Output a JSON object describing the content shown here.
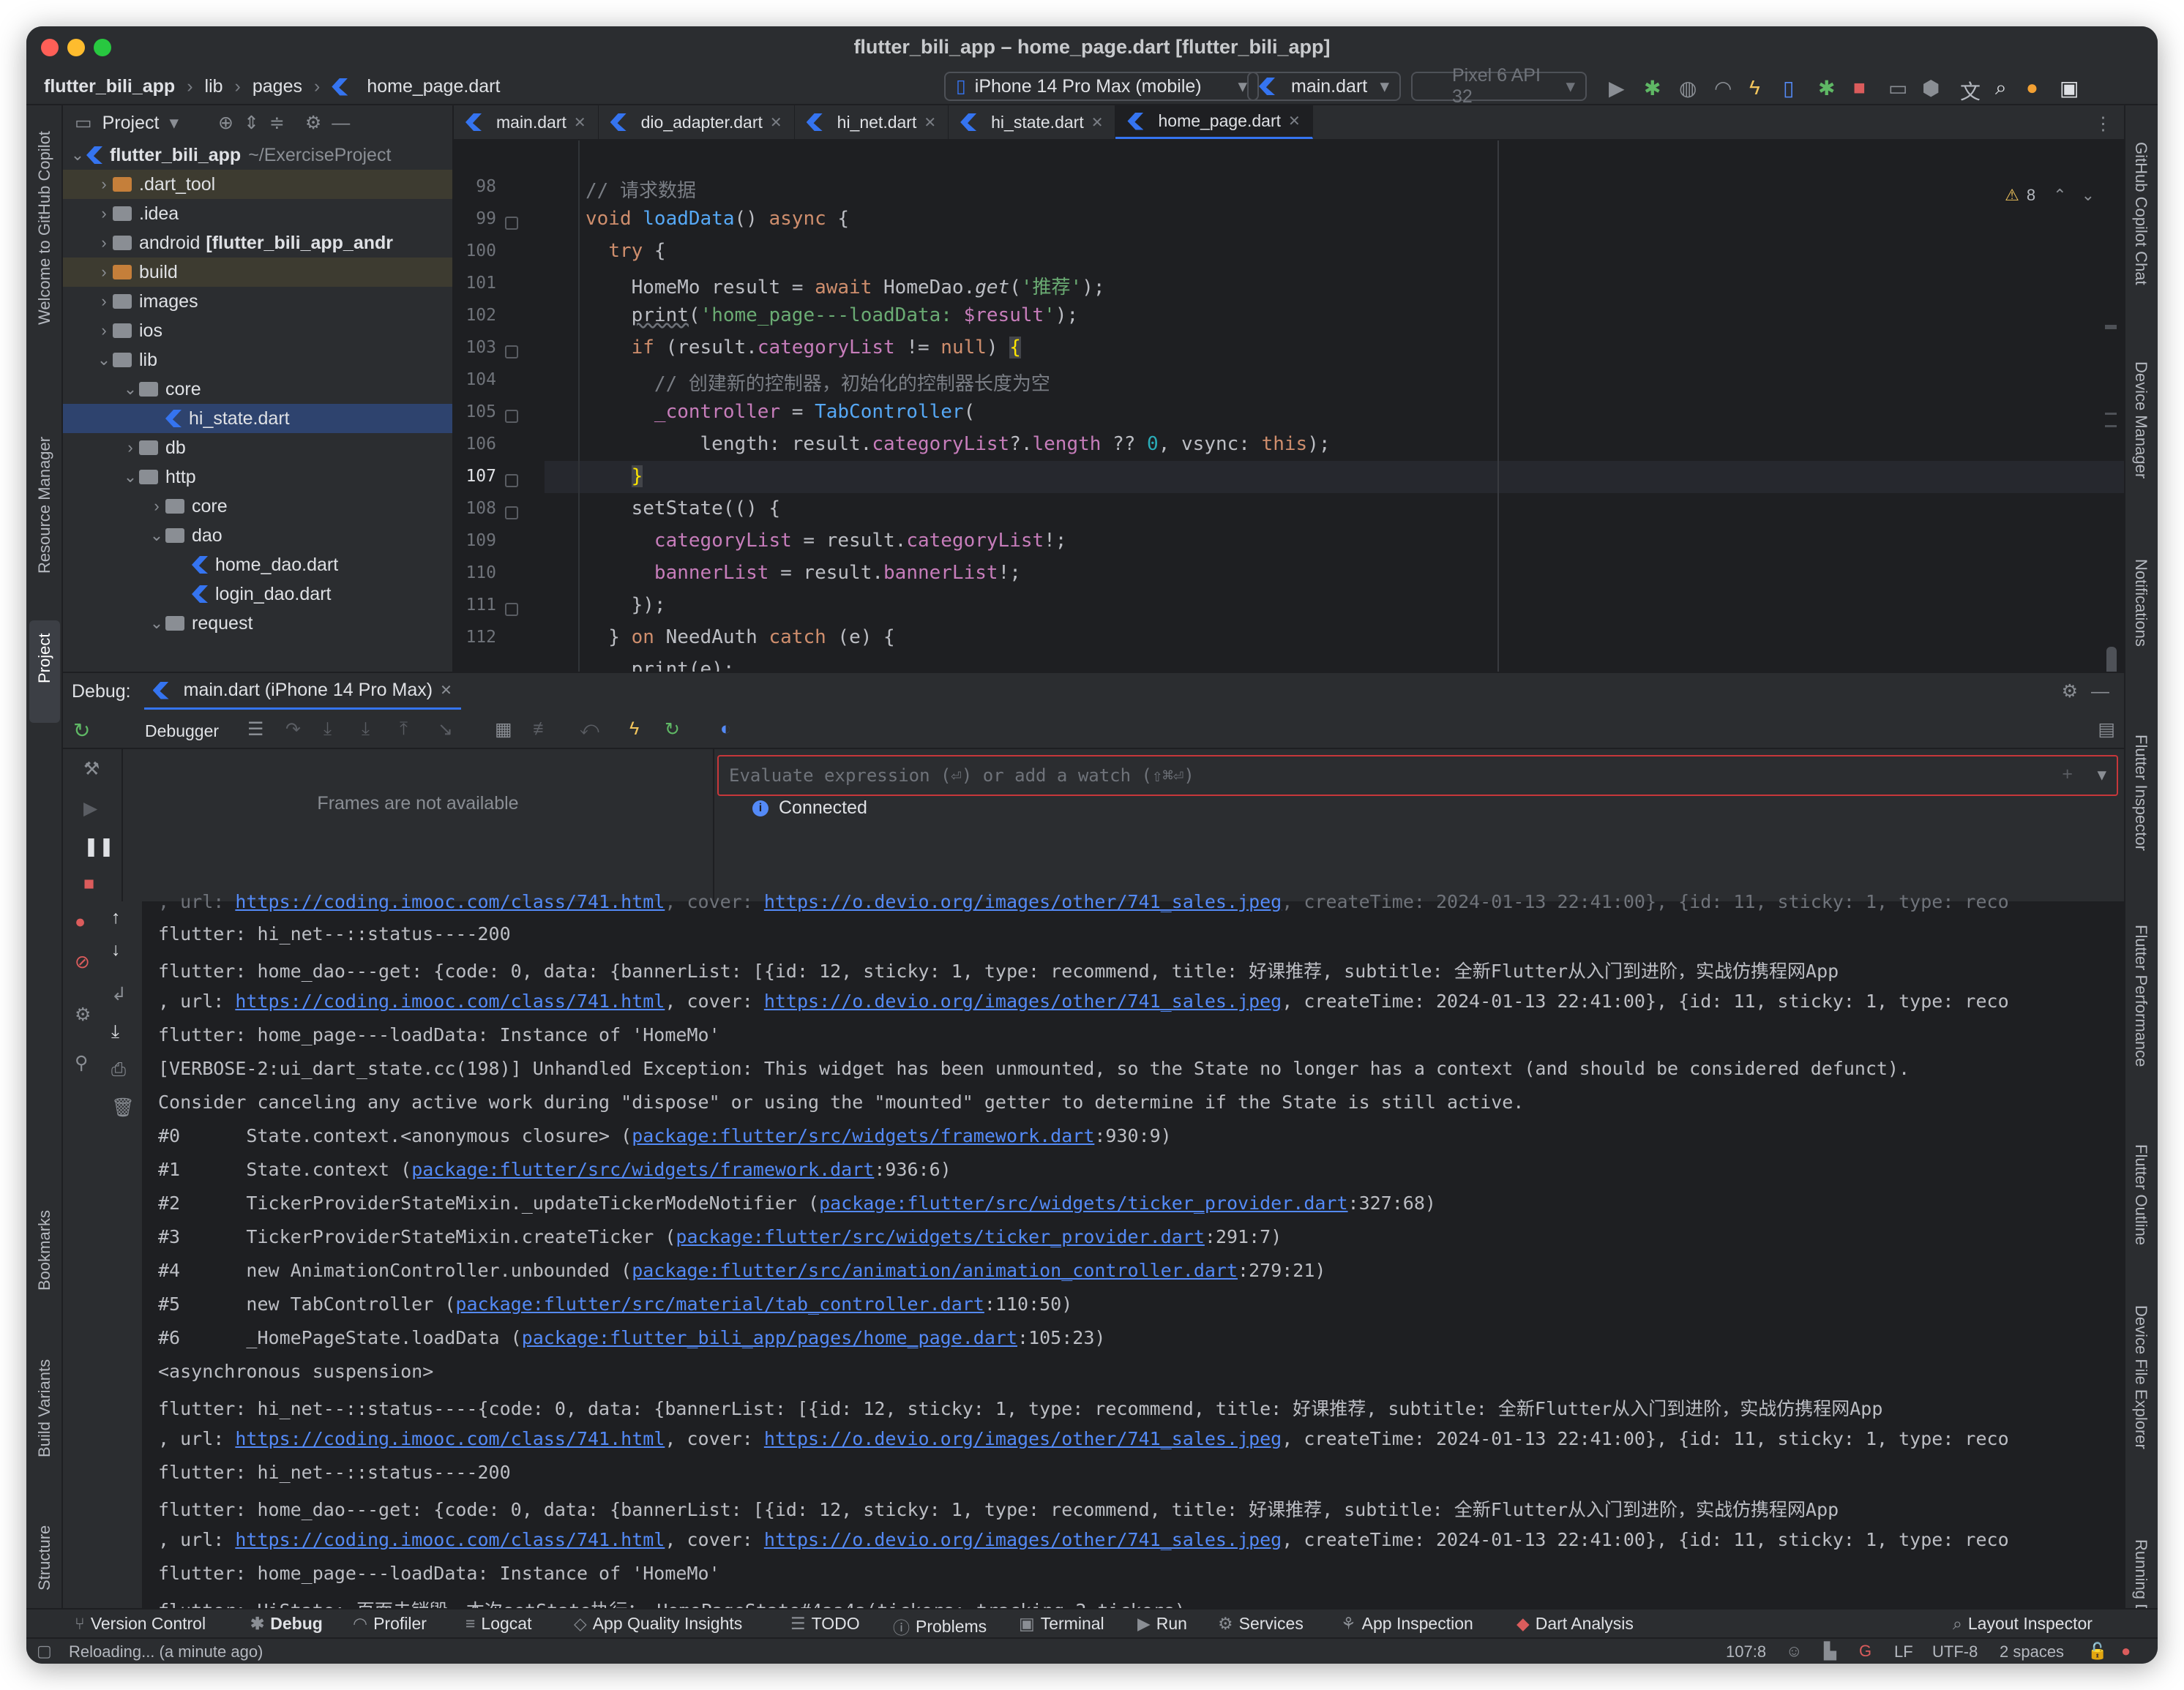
{
  "window": {
    "title": "flutter_bili_app – home_page.dart [flutter_bili_app]"
  },
  "breadcrumb": [
    "flutter_bili_app",
    "lib",
    "pages",
    "home_page.dart"
  ],
  "toolbar": {
    "device": "iPhone 14 Pro Max (mobile)",
    "run_config": "main.dart",
    "emulator": "Pixel 6 API 32"
  },
  "project_panel": {
    "title": "Project",
    "root": {
      "name": "flutter_bili_app",
      "path": "~/ExerciseProject"
    },
    "items": [
      {
        "label": ".dart_tool",
        "depth": 1,
        "expanded": false,
        "type": "folder-orange"
      },
      {
        "label": ".idea",
        "depth": 1,
        "expanded": false,
        "type": "folder"
      },
      {
        "label": "android",
        "extra": "[flutter_bili_app_andr",
        "depth": 1,
        "expanded": false,
        "type": "folder"
      },
      {
        "label": "build",
        "depth": 1,
        "expanded": false,
        "type": "folder-orange"
      },
      {
        "label": "images",
        "depth": 1,
        "expanded": false,
        "type": "folder"
      },
      {
        "label": "ios",
        "depth": 1,
        "expanded": false,
        "type": "folder"
      },
      {
        "label": "lib",
        "depth": 1,
        "expanded": true,
        "type": "folder"
      },
      {
        "label": "core",
        "depth": 2,
        "expanded": true,
        "type": "folder"
      },
      {
        "label": "hi_state.dart",
        "depth": 3,
        "type": "dart",
        "selected": true
      },
      {
        "label": "db",
        "depth": 2,
        "expanded": false,
        "type": "folder"
      },
      {
        "label": "http",
        "depth": 2,
        "expanded": true,
        "type": "folder"
      },
      {
        "label": "core",
        "depth": 3,
        "expanded": false,
        "type": "folder"
      },
      {
        "label": "dao",
        "depth": 3,
        "expanded": true,
        "type": "folder"
      },
      {
        "label": "home_dao.dart",
        "depth": 4,
        "type": "dart"
      },
      {
        "label": "login_dao.dart",
        "depth": 4,
        "type": "dart"
      },
      {
        "label": "request",
        "depth": 3,
        "expanded": true,
        "type": "folder"
      }
    ]
  },
  "editor": {
    "tabs": [
      "main.dart",
      "dio_adapter.dart",
      "hi_net.dart",
      "hi_state.dart",
      "home_page.dart"
    ],
    "active_tab": "home_page.dart",
    "warnings": "8",
    "line_numbers": [
      "98",
      "99",
      "100",
      "101",
      "102",
      "103",
      "104",
      "105",
      "106",
      "107",
      "108",
      "109",
      "110",
      "111",
      "112"
    ],
    "current_line": "107"
  },
  "left_tool_windows": [
    "Welcome to GitHub Copilot",
    "Resource Manager",
    "Project",
    "Bookmarks",
    "Build Variants",
    "Structure"
  ],
  "right_tool_windows": [
    "GitHub Copilot Chat",
    "Device Manager",
    "Notifications",
    "Flutter Inspector",
    "Flutter Performance",
    "Flutter Outline",
    "Device File Explorer",
    "Running Devi"
  ],
  "debug": {
    "label": "Debug:",
    "session": "main.dart (iPhone 14 Pro Max)",
    "debugger_tab": "Debugger",
    "frames_empty": "Frames are not available",
    "eval_placeholder": "Evaluate expression (⏎) or add a watch (⇧⌘⏎)",
    "status": "Connected"
  },
  "bottom_tools": [
    "Version Control",
    "Debug",
    "Profiler",
    "Logcat",
    "App Quality Insights",
    "TODO",
    "Problems",
    "Terminal",
    "Run",
    "Services",
    "App Inspection",
    "Dart Analysis",
    "Layout Inspector"
  ],
  "status_bar": {
    "message": "Reloading... (a minute ago)",
    "position": "107:8",
    "line_sep": "LF",
    "encoding": "UTF-8",
    "indent": "2 spaces"
  },
  "colors": {
    "accent": "#3574f0",
    "error": "#c7373a",
    "link": "#548af7"
  }
}
